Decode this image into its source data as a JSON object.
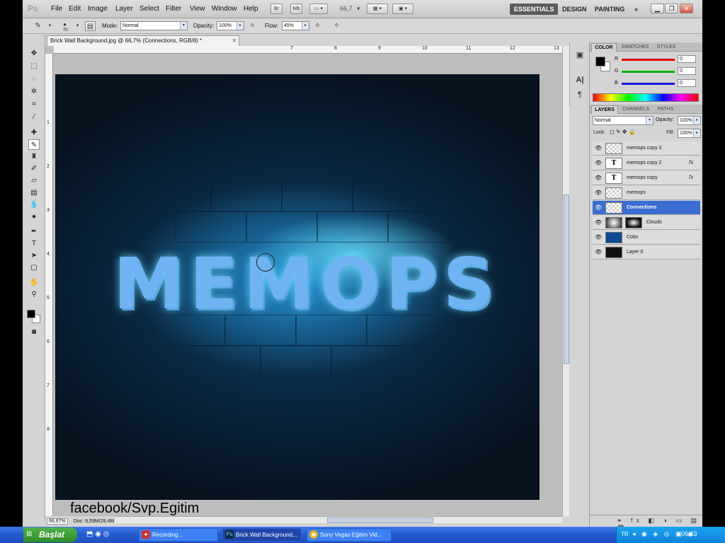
{
  "app": {
    "logo": "Ps",
    "menus": [
      "File",
      "Edit",
      "Image",
      "Layer",
      "Select",
      "Filter",
      "View",
      "Window",
      "Help"
    ],
    "bridge_btn": "Br",
    "minibridge_btn": "Mb",
    "zoom": "66,7",
    "workspaces": [
      "ESSENTIALS",
      "DESIGN",
      "PAINTING",
      "»"
    ]
  },
  "options": {
    "brush_size": "70",
    "mode_label": "Mode:",
    "mode_value": "Normal",
    "opacity_label": "Opacity:",
    "opacity_value": "100%",
    "flow_label": "Flow:",
    "flow_value": "45%"
  },
  "document": {
    "tab_title": "Brick Wall Background.jpg @ 66,7% (Connections, RGB/8) *",
    "canvas_text": "MEMOPS",
    "ruler_top": [
      "7",
      "8",
      "9",
      "10",
      "11",
      "12",
      "13"
    ],
    "ruler_left": [
      "1",
      "2",
      "3",
      "4",
      "5",
      "6",
      "7",
      "8"
    ],
    "status_zoom": "66,67%",
    "status_doc": "Doc: 6,59M/29,4M"
  },
  "watermark": "facebook/Svp.Egitim",
  "color_panel": {
    "tabs": [
      "COLOR",
      "SWATCHES",
      "STYLES"
    ],
    "channels": [
      {
        "label": "R",
        "value": "0",
        "color": "#e00000"
      },
      {
        "label": "G",
        "value": "0",
        "color": "#00b000"
      },
      {
        "label": "B",
        "value": "0",
        "color": "#1a1ae0"
      }
    ]
  },
  "layers_panel": {
    "tabs": [
      "LAYERS",
      "CHANNELS",
      "PATHS"
    ],
    "blend_mode": "Normal",
    "opacity_label": "Opacity:",
    "opacity_value": "100%",
    "lock_label": "Lock:",
    "fill_label": "Fill:",
    "fill_value": "100%",
    "layers": [
      {
        "name": "memops copy 3",
        "thumb": "check",
        "fx": ""
      },
      {
        "name": "memops copy 2",
        "thumb": "type",
        "fx": "fx"
      },
      {
        "name": "memops copy",
        "thumb": "type",
        "fx": "fx"
      },
      {
        "name": "memops",
        "thumb": "check",
        "fx": ""
      },
      {
        "name": "Connections",
        "thumb": "check",
        "fx": "",
        "selected": true
      },
      {
        "name": "Clouds",
        "thumb": "clouds",
        "fx": ""
      },
      {
        "name": "Color",
        "thumb": "color",
        "fx": ""
      },
      {
        "name": "Layer 0",
        "thumb": "dark",
        "fx": ""
      }
    ]
  },
  "taskbar": {
    "start": "Başlat",
    "tasks": [
      "Recording...",
      "Brick Wall Background...",
      "Sony Vegas Eğitim Vid..."
    ],
    "lang": "TR",
    "clock": "06:43"
  }
}
